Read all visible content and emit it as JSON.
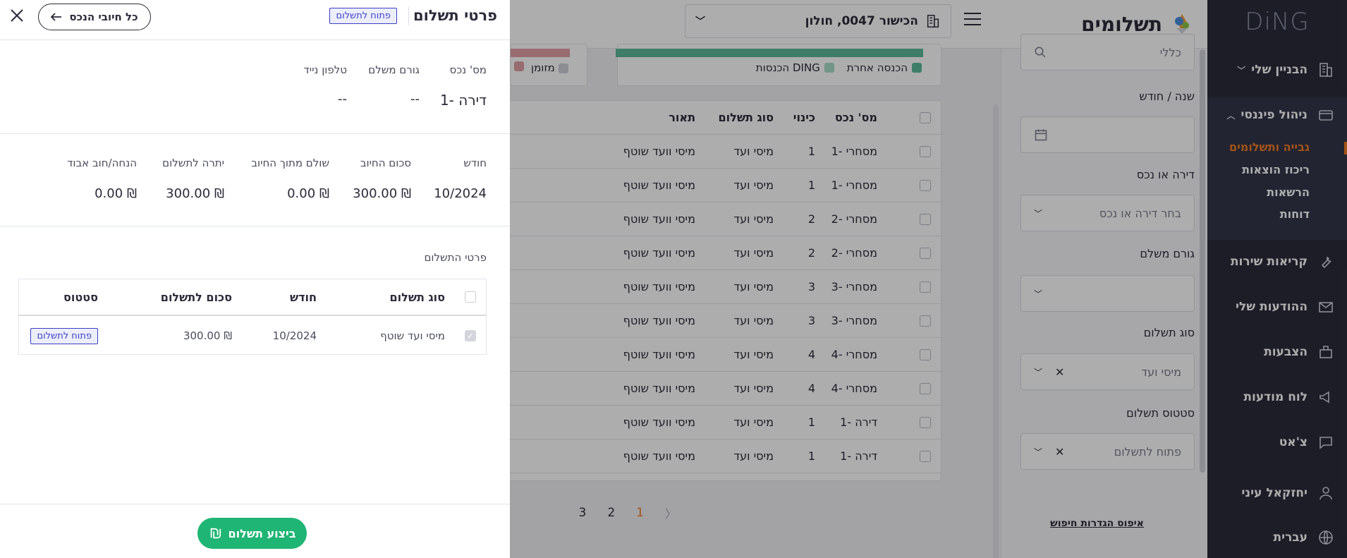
{
  "sidebar": {
    "logo": "DiNG",
    "items": [
      {
        "label": "הבניין שלי",
        "icon": "building-icon"
      },
      {
        "label": "ניהול פיננסי",
        "icon": "wallet-icon"
      },
      {
        "label": "קריאות שירות",
        "icon": "wrench-icon"
      },
      {
        "label": "ההודעות שלי",
        "icon": "mail-icon"
      },
      {
        "label": "הצבעות",
        "icon": "ballot-icon"
      },
      {
        "label": "לוח מודעות",
        "icon": "megaphone-icon"
      },
      {
        "label": "צ'אט",
        "icon": "chat-icon"
      },
      {
        "label": "יחזקאל עיני",
        "icon": "user-icon"
      },
      {
        "label": "עברית",
        "icon": "globe-icon"
      }
    ],
    "sub_items": [
      "גבייה ותשלומים",
      "ריכוז הוצאות",
      "הרשאות",
      "דוחות"
    ]
  },
  "filter_panel": {
    "title": "תשלומים",
    "search_placeholder": "כללי",
    "labels": {
      "year_month": "שנה / חודש",
      "apartment": "דירה או נכס",
      "payer": "גורם משלם",
      "payment_type": "סוג תשלום",
      "payment_status": "סטטוס תשלום"
    },
    "apartment_placeholder": "בחר דירה או נכס",
    "payment_type_value": "מיסי ועד",
    "payment_status_value": "פתוח לתשלום",
    "reset_label": "איפוס הגדרות חיפוש"
  },
  "main": {
    "building": "הכישור 0047, חולון",
    "legend": [
      "הכנסה אחרת",
      "DING הכנסות"
    ],
    "legend2": [
      "מזומן"
    ],
    "table": {
      "headers": [
        "מס' נכס",
        "כינוי",
        "סוג תשלום",
        "תאור"
      ],
      "rows": [
        [
          "מסחרי -1",
          "1",
          "מיסי ועד",
          "מיסי וועד שוטף"
        ],
        [
          "מסחרי -1",
          "1",
          "מיסי ועד",
          "מיסי וועד שוטף"
        ],
        [
          "מסחרי -2",
          "2",
          "מיסי ועד",
          "מיסי וועד שוטף"
        ],
        [
          "מסחרי -2",
          "2",
          "מיסי ועד",
          "מיסי וועד שוטף"
        ],
        [
          "מסחרי -3",
          "3",
          "מיסי ועד",
          "מיסי וועד שוטף"
        ],
        [
          "מסחרי -3",
          "3",
          "מיסי ועד",
          "מיסי וועד שוטף"
        ],
        [
          "מסחרי -4",
          "4",
          "מיסי ועד",
          "מיסי וועד שוטף"
        ],
        [
          "מסחרי -4",
          "4",
          "מיסי ועד",
          "מיסי וועד שוטף"
        ],
        [
          "דירה -1",
          "1",
          "מיסי ועד",
          "מיסי וועד שוטף"
        ],
        [
          "דירה -1",
          "1",
          "מיסי ועד",
          "מיסי וועד שוטף"
        ]
      ]
    },
    "pager": [
      "1",
      "2",
      "3"
    ]
  },
  "drawer": {
    "title": "פרטי תשלום",
    "status_badge": "פתוח לתשלום",
    "back_label": "כל חיובי הנכס",
    "property": {
      "headers": [
        "מס' נכס",
        "גורם משלם",
        "טלפון נייד"
      ],
      "values": [
        "דירה -1",
        "--",
        "--"
      ]
    },
    "charge": {
      "headers": [
        "חודש",
        "סכום החיוב",
        "שולם מתוך החיוב",
        "יתרה לתשלום",
        "הנחה/חוב אבוד"
      ],
      "values": [
        "10/2024",
        "₪ 300.00",
        "₪ 0.00",
        "₪ 300.00",
        "₪ 0.00"
      ]
    },
    "details_title": "פרטי התשלום",
    "pay_table": {
      "headers": [
        "סוג תשלום",
        "חודש",
        "סכום לתשלום",
        "סטטוס"
      ],
      "row": {
        "type": "מיסי ועד שוטף",
        "month": "10/2024",
        "amount": "₪ 300.00",
        "status": "פתוח לתשלום"
      }
    },
    "pay_button": "ביצוע תשלום"
  }
}
